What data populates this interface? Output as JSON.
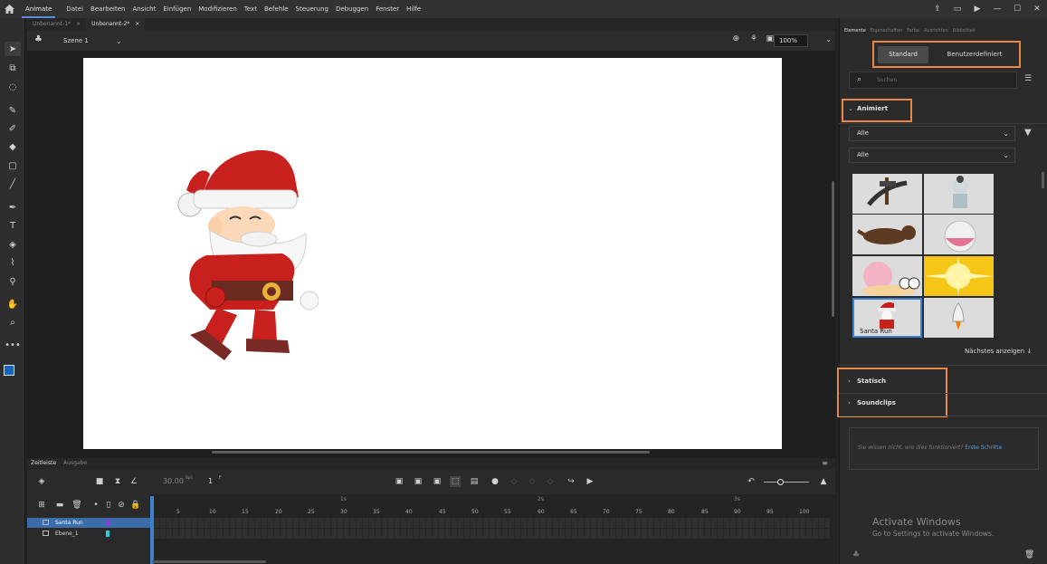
{
  "menubar": {
    "app_name": "Animate",
    "items": [
      "Datei",
      "Bearbeiten",
      "Ansicht",
      "Einfügen",
      "Modifizieren",
      "Text",
      "Befehle",
      "Steuerung",
      "Debuggen",
      "Fenster",
      "Hilfe"
    ]
  },
  "doc_tabs": [
    {
      "label": "Unbenannt-1*",
      "close": "×"
    },
    {
      "label": "Unbenannt-2*",
      "close": "×"
    }
  ],
  "scene": {
    "label": "Szene 1",
    "zoom": "100%"
  },
  "timeline": {
    "tabs": [
      "Zeitleiste",
      "Ausgabe"
    ],
    "fps": "30.00",
    "fps_unit": "BpS",
    "frame": "1",
    "frame_unit": "F",
    "layers": [
      {
        "name": "Santa Run",
        "color": "#8a3fd8",
        "selected": true
      },
      {
        "name": "Ebene_1",
        "color": "#22d3d3",
        "selected": false
      }
    ],
    "ticks": [
      "5",
      "10",
      "15",
      "20",
      "25",
      "30",
      "35",
      "40",
      "45",
      "50",
      "55",
      "60",
      "65",
      "70",
      "75",
      "80",
      "85",
      "90",
      "95",
      "100"
    ],
    "seconds": [
      "1s",
      "2s",
      "3s"
    ]
  },
  "panel": {
    "tabs": [
      "Elemente",
      "Eigenschaften",
      "Farbe",
      "Ausrichten",
      "Bibliothek"
    ],
    "segment": {
      "standard": "Standard",
      "custom": "Benutzerdefiniert"
    },
    "search_placeholder": "Suchen",
    "section_animated": "Animiert",
    "filter1": "Alle",
    "filter2": "Alle",
    "selected_asset_label": "Santa Run",
    "more": "Nächstes anzeigen ↓",
    "section_static": "Statisch",
    "section_sound": "Soundclips",
    "help_text": "Sie wissen nicht, wie dies funktioniert?",
    "help_link": "Erste Schritte"
  },
  "watermark": {
    "title": "Activate Windows",
    "subtitle": "Go to Settings to activate Windows."
  },
  "colors": {
    "accent": "#3d7fd0",
    "highlight_box": "#e8894a",
    "stage": "#ffffff"
  }
}
